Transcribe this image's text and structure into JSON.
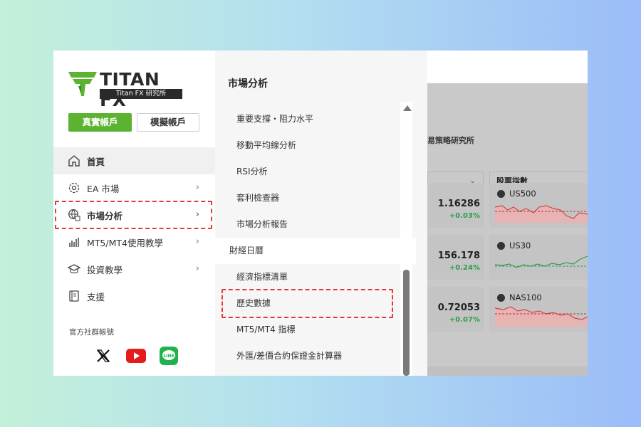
{
  "brand": {
    "name": "TITAN FX",
    "subtitle": "Titan FX 研究所",
    "accent": "#5cb332"
  },
  "account_buttons": {
    "real": "真實帳戶",
    "demo": "模擬帳戶"
  },
  "nav": {
    "items": [
      {
        "label": "首頁",
        "icon": "home-icon"
      },
      {
        "label": "EA 市場",
        "icon": "ea-gear-icon"
      },
      {
        "label": "市場分析",
        "icon": "globe-chart-icon"
      },
      {
        "label": "MT5/MT4使用教學",
        "icon": "bar-chart-icon"
      },
      {
        "label": "投資教學",
        "icon": "graduation-cap-icon"
      },
      {
        "label": "支援",
        "icon": "book-icon"
      }
    ]
  },
  "social": {
    "label": "官方社群帳號",
    "icons": [
      "x-icon",
      "youtube-icon",
      "line-icon"
    ]
  },
  "submenu": {
    "title": "市場分析",
    "items": [
      "重要支撐・阻力水平",
      "移動平均線分析",
      "RSI分析",
      "套利檢查器",
      "市場分析報告",
      "財經日曆",
      "經濟指標清單",
      "歷史數據",
      "MT5/MT4 指標",
      "外匯/差價合約保證金計算器"
    ]
  },
  "background_page": {
    "title": "易策略研究所",
    "dropdown_right": "股票指數",
    "quotes": [
      {
        "price": "1.16286",
        "change": "+0.03%"
      },
      {
        "price": "156.178",
        "change": "+0.24%"
      },
      {
        "price": "0.72053",
        "change": "+0.07%"
      }
    ],
    "cards": [
      {
        "symbol": "US500",
        "trend": "down"
      },
      {
        "symbol": "US30",
        "trend": "up"
      },
      {
        "symbol": "NAS100",
        "trend": "down"
      }
    ]
  }
}
